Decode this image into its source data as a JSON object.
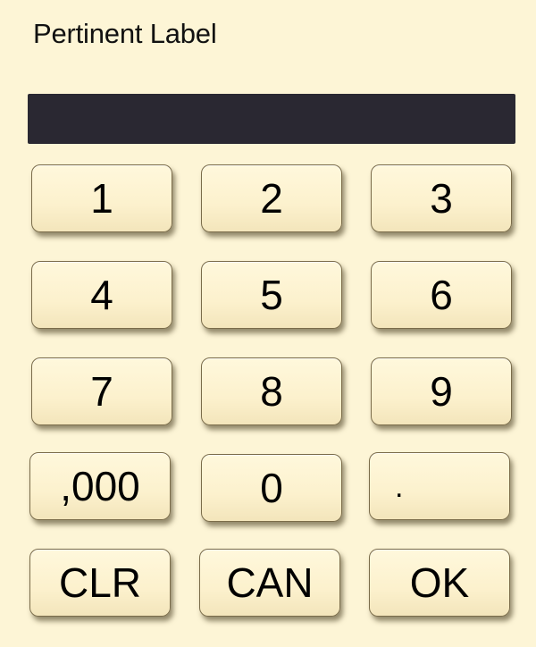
{
  "label": "Pertinent Label",
  "display": {
    "value": ""
  },
  "keys": {
    "k1": "1",
    "k2": "2",
    "k3": "3",
    "k4": "4",
    "k5": "5",
    "k6": "6",
    "k7": "7",
    "k8": "8",
    "k9": "9",
    "thousands": ",000",
    "k0": "0",
    "decimal": ".",
    "clear": "CLR",
    "cancel": "CAN",
    "ok": "OK"
  },
  "colors": {
    "background": "#fdf5d6",
    "display": "#2a2832",
    "key_face": "#fcf1cd",
    "key_border": "#7a6c4a"
  }
}
